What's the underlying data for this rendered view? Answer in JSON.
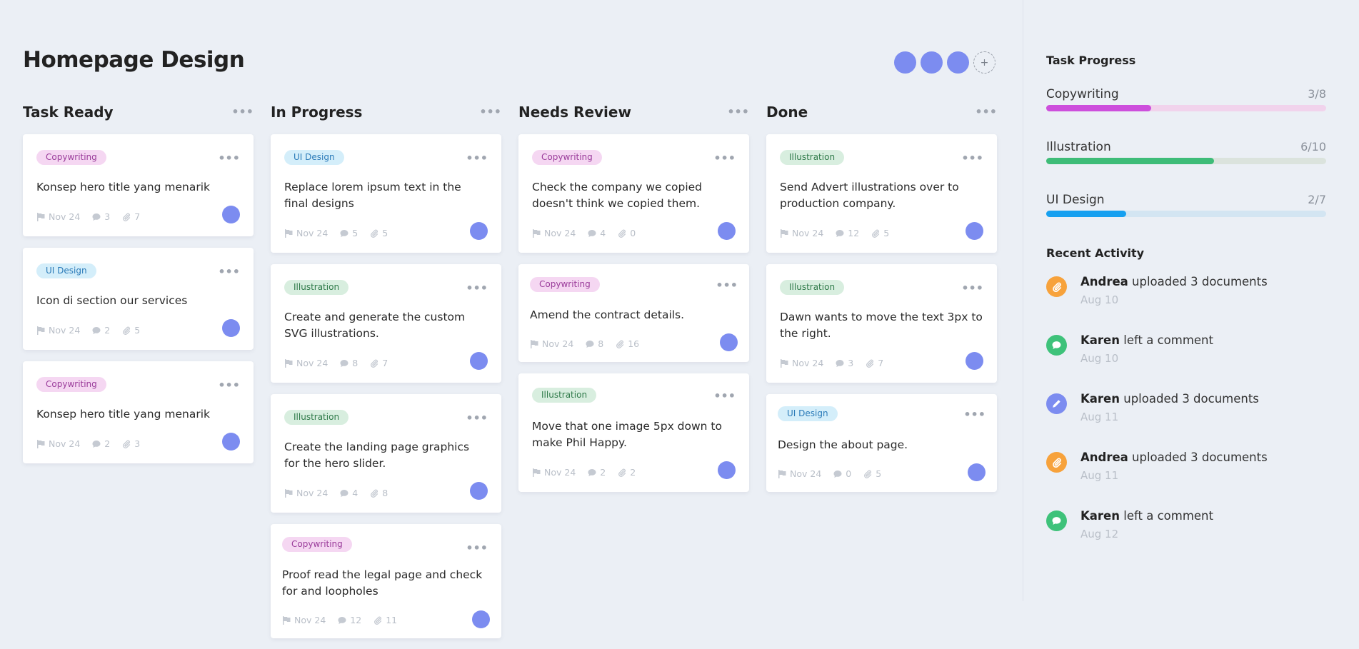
{
  "header": {
    "title": "Homepage Design",
    "add_member_label": "+"
  },
  "colors": {
    "avatar": "#7c8cf0",
    "copywriting": "#cd4fdc",
    "illustration": "#3ebc78",
    "ui_design": "#16a0f0"
  },
  "icons": {
    "column_menu": "more-horizontal-icon",
    "card_menu": "more-horizontal-icon",
    "due_date": "flag-icon",
    "comments": "comment-icon",
    "attachments": "paperclip-icon",
    "activity_upload": "paperclip-icon",
    "activity_comment": "comment-icon",
    "activity_edit": "pencil-icon"
  },
  "board": {
    "columns": [
      {
        "title": "Task Ready",
        "cards": [
          {
            "tag": "Copywriting",
            "tag_type": "copy",
            "title": "Konsep hero title yang menarik",
            "date": "Nov 24",
            "comments": "3",
            "attachments": "7"
          },
          {
            "tag": "UI Design",
            "tag_type": "ui",
            "title": "Icon di section our services",
            "date": "Nov 24",
            "comments": "2",
            "attachments": "5"
          },
          {
            "tag": "Copywriting",
            "tag_type": "copy",
            "title": "Konsep hero title yang menarik",
            "date": "Nov 24",
            "comments": "2",
            "attachments": "3"
          }
        ]
      },
      {
        "title": "In Progress",
        "cards": [
          {
            "tag": "UI Design",
            "tag_type": "ui",
            "title": "Replace lorem ipsum text in the final designs",
            "date": "Nov 24",
            "comments": "5",
            "attachments": "5"
          },
          {
            "tag": "Illustration",
            "tag_type": "ill",
            "title": "Create and generate the custom SVG illustrations.",
            "date": "Nov 24",
            "comments": "8",
            "attachments": "7"
          },
          {
            "tag": "Illustration",
            "tag_type": "ill",
            "title": "Create the landing page graphics for the hero slider.",
            "date": "Nov 24",
            "comments": "4",
            "attachments": "8"
          },
          {
            "tag": "Copywriting",
            "tag_type": "copy",
            "title": "Proof read the legal page and check for and loopholes",
            "date": "Nov 24",
            "comments": "12",
            "attachments": "11"
          }
        ]
      },
      {
        "title": "Needs Review",
        "cards": [
          {
            "tag": "Copywriting",
            "tag_type": "copy",
            "title": "Check the company we copied doesn't think we copied them.",
            "date": "Nov 24",
            "comments": "4",
            "attachments": "0"
          },
          {
            "tag": "Copywriting",
            "tag_type": "copy",
            "title": "Amend the contract details.",
            "date": "Nov 24",
            "comments": "8",
            "attachments": "16"
          },
          {
            "tag": "Illustration",
            "tag_type": "ill",
            "title": "Move that one image 5px down to make Phil Happy.",
            "date": "Nov 24",
            "comments": "2",
            "attachments": "2"
          }
        ]
      },
      {
        "title": "Done",
        "cards": [
          {
            "tag": "Illustration",
            "tag_type": "ill",
            "title": "Send Advert illustrations over to production company.",
            "date": "Nov 24",
            "comments": "12",
            "attachments": "5"
          },
          {
            "tag": "Illustration",
            "tag_type": "ill",
            "title": "Dawn wants to move the text 3px to the right.",
            "date": "Nov 24",
            "comments": "3",
            "attachments": "7"
          },
          {
            "tag": "UI Design",
            "tag_type": "ui",
            "title": "Design the about page.",
            "date": "Nov 24",
            "comments": "0",
            "attachments": "5"
          }
        ]
      }
    ]
  },
  "sidebar": {
    "progress_heading": "Task Progress",
    "progress": [
      {
        "label": "Copywriting",
        "count": "3/8",
        "fraction": 0.375,
        "color": "#cd4fdc",
        "track": "#f1d3ec"
      },
      {
        "label": "Illustration",
        "count": "6/10",
        "fraction": 0.6,
        "color": "#3ebc78",
        "track": "#dbe3dd"
      },
      {
        "label": "UI Design",
        "count": "2/7",
        "fraction": 0.2857,
        "color": "#16a0f0",
        "track": "#d3e5f2"
      }
    ],
    "activity_heading": "Recent Activity",
    "activity": [
      {
        "user": "Andrea",
        "action": "uploaded 3 documents",
        "date": "Aug 10",
        "icon": "paperclip-icon",
        "color": "#f7a23b"
      },
      {
        "user": "Karen",
        "action": "left a comment",
        "date": "Aug 10",
        "icon": "comment-icon",
        "color": "#3ec27a"
      },
      {
        "user": "Karen",
        "action": "uploaded 3 documents",
        "date": "Aug 11",
        "icon": "pencil-icon",
        "color": "#7c8cf0"
      },
      {
        "user": "Andrea",
        "action": "uploaded 3 documents",
        "date": "Aug 11",
        "icon": "paperclip-icon",
        "color": "#f7a23b"
      },
      {
        "user": "Karen",
        "action": "left a comment",
        "date": "Aug 12",
        "icon": "comment-icon",
        "color": "#3ec27a"
      }
    ]
  }
}
